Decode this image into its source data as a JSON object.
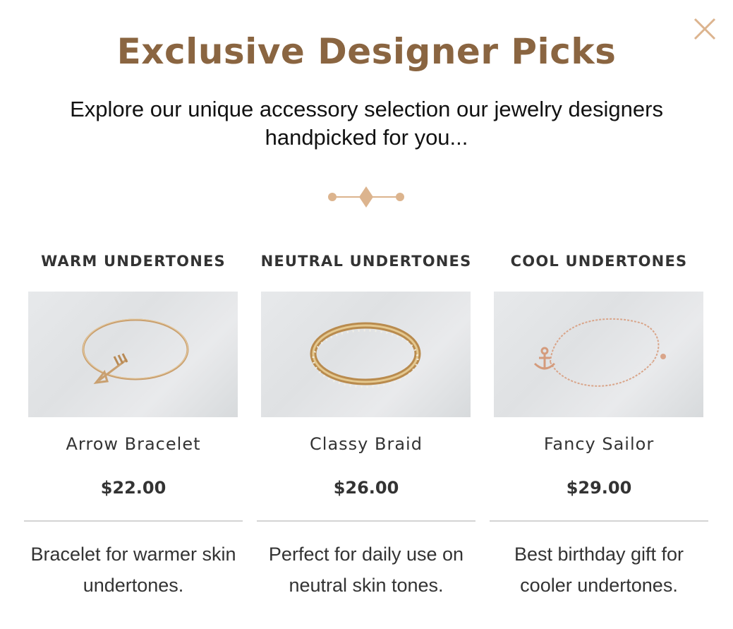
{
  "modal": {
    "title": "Exclusive Designer Picks",
    "subtitle": "Explore our unique accessory selection our jewelry designers handpicked for you...",
    "close_icon": "close-icon"
  },
  "colors": {
    "title": "#8a6541",
    "accent": "#dcb48e",
    "text": "#333333",
    "divider": "#d3d3d3"
  },
  "columns": [
    {
      "heading": "WARM UNDERTONES",
      "product": "Arrow Bracelet",
      "price": "$22.00",
      "description": "Bracelet for warmer skin undertones.",
      "image_icon": "arrow-bracelet-image"
    },
    {
      "heading": "NEUTRAL UNDERTONES",
      "product": "Classy Braid",
      "price": "$26.00",
      "description": "Perfect for daily use on neutral skin tones.",
      "image_icon": "bangle-bracelet-image"
    },
    {
      "heading": "COOL UNDERTONES",
      "product": "Fancy Sailor",
      "price": "$29.00",
      "description": "Best birthday gift for cooler undertones.",
      "image_icon": "anchor-bracelet-image"
    }
  ]
}
